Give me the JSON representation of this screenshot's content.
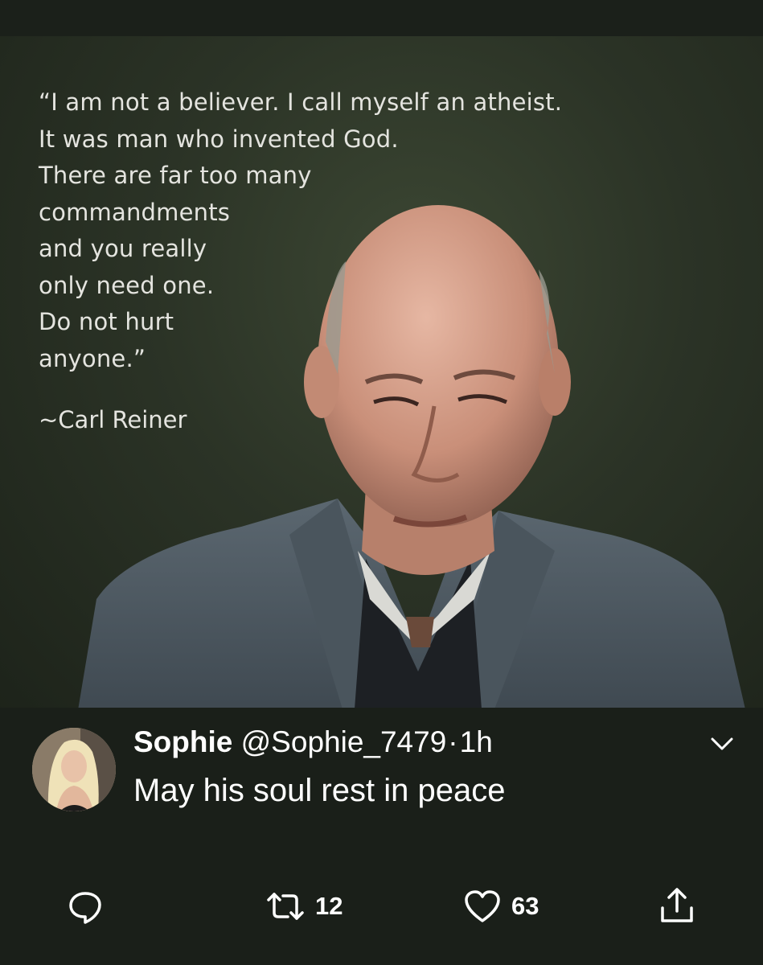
{
  "media": {
    "quote_lines": [
      "“I am not a believer. I call myself an atheist.",
      "It was man who invented God.",
      "There are far too many",
      "commandments",
      "and you really",
      "only need one.",
      "Do not hurt",
      "anyone.”"
    ],
    "attribution": "~Carl Reiner"
  },
  "tweet": {
    "display_name": "Sophie",
    "handle": "@Sophie_7479",
    "separator": "·",
    "time": "1h",
    "text": "May his soul rest in peace"
  },
  "actions": {
    "reply_icon": "reply-icon",
    "retweet_icon": "retweet-icon",
    "retweet_count": "12",
    "like_icon": "heart-icon",
    "like_count": "63",
    "share_icon": "share-icon"
  },
  "colors": {
    "background": "#1a1f19",
    "text": "#ffffff"
  }
}
